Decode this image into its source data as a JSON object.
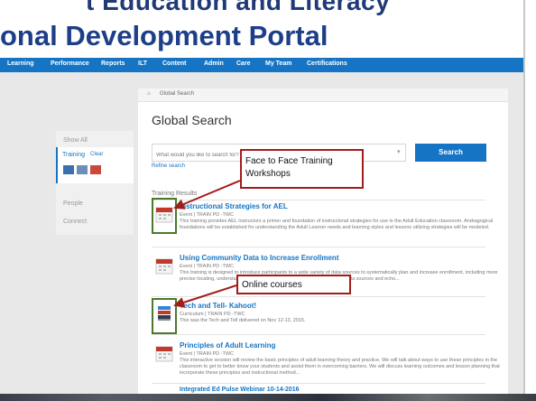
{
  "header": {
    "top_title": "t Education and Literacy",
    "portal_title": "onal Development Portal"
  },
  "nav": {
    "items": [
      "Learning",
      "Performance",
      "Reports",
      "ILT",
      "Content",
      "Admin",
      "Care",
      "My Team",
      "Certifications"
    ]
  },
  "breadcrumb": {
    "label": "Global Search"
  },
  "left_panel": {
    "show_all": "Show All",
    "training": "Training",
    "clear": "Clear",
    "people": "People",
    "connect": "Connect"
  },
  "page": {
    "title": "Global Search"
  },
  "search": {
    "placeholder": "What would you like to search for?",
    "button": "Search",
    "refine": "Refine search"
  },
  "results_header": "Training Results",
  "results": [
    {
      "title": "Instructional Strategies for AEL",
      "meta": "Event  |  TRAIN PD -TWC",
      "desc": "This training provides AEL instructors a primer and foundation of instructional strategies for use in the Adult Education classroom. Andragogical foundations will be established for understanding the Adult Learner needs and learning styles and lessons utilizing strategies will be modeled."
    },
    {
      "title": "Using Community Data to Increase Enrollment",
      "meta": "Event  |  TRAIN PD -TWC",
      "desc": "This training is designed to introduce participants to a wide variety of data sources to systematically plan and increase enrollment, including more precise locating, understanding, prioritizing, analyzing, and using important data sources and echo..."
    },
    {
      "title": "Tech and Tell- Kahoot!",
      "meta": "Curriculum  |  TRAIN PD -TWC",
      "desc": "This was the Tech and Tell delivered on Nov 12-13, 2015."
    },
    {
      "title": "Principles of Adult Learning",
      "meta": "Event  |  TRAIN PD -TWC",
      "desc": "This interactive session will review the basic principles of adult learning theory and practice. We will talk about ways to use these principles in the classroom to get to better know your students and assist them in overcoming barriers. We will discuss learning outcomes and lesson planning that incorporate these principles and instructional method..."
    }
  ],
  "partial_last": "Integrated Ed Pulse Webinar 10-14-2016",
  "callouts": {
    "face_to_face": "Face to Face Training Workshops",
    "online": "Online courses"
  },
  "colors": {
    "accent": "#1575c4",
    "callout_border": "#a31c1c",
    "highlight_box": "#4a7a2a",
    "event_icon": "#c0392b"
  }
}
